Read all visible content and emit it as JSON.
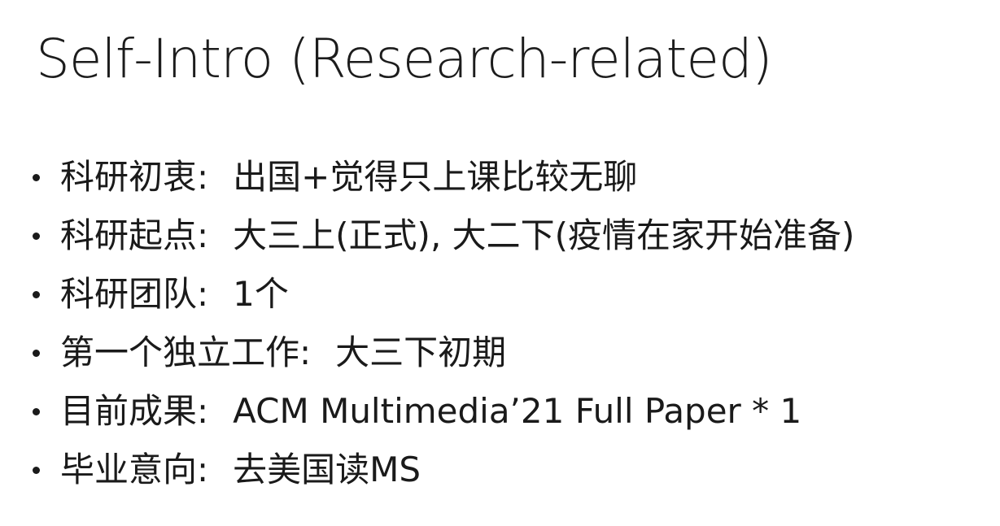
{
  "slide": {
    "title": "Self-Intro (Research-related)",
    "items": [
      {
        "label": "科研初衷",
        "sep": ":",
        "value": "出国+觉得只上课比较无聊"
      },
      {
        "label": "科研起点",
        "sep": ":",
        "value": "大三上(正式), 大二下(疫情在家开始准备)"
      },
      {
        "label": "科研团队",
        "sep": ":",
        "value": "1个"
      },
      {
        "label": "第一个独立工作",
        "sep": ":",
        "value": "大三下初期"
      },
      {
        "label": "目前成果",
        "sep": ":",
        "value": "ACM Multimedia’21 Full Paper * 1"
      },
      {
        "label": "毕业意向",
        "sep": ":",
        "value": "去美国读MS"
      }
    ]
  },
  "colors": {
    "background": "#ffffff",
    "text": "#1a1a1a"
  }
}
